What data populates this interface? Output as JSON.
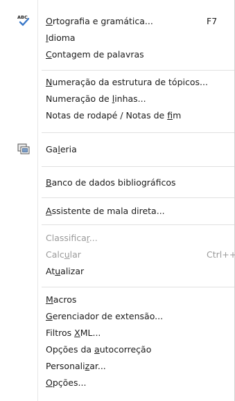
{
  "menu": {
    "group1": [
      {
        "pre": "",
        "key": "O",
        "post": "rtografia e gramática...",
        "shortcut": "F7",
        "icon": "spellcheck-icon"
      },
      {
        "pre": "",
        "key": "I",
        "post": "dioma",
        "shortcut": ""
      },
      {
        "pre": "",
        "key": "C",
        "post": "ontagem de palavras",
        "shortcut": ""
      }
    ],
    "group2": [
      {
        "pre": "",
        "key": "N",
        "post": "umeração da estrutura de tópicos...",
        "shortcut": ""
      },
      {
        "pre": "Numeração de ",
        "key": "l",
        "post": "inhas...",
        "shortcut": ""
      },
      {
        "pre": "Notas de rodapé / Notas de ",
        "key": "f",
        "post": "im",
        "shortcut": ""
      }
    ],
    "group3": [
      {
        "pre": "Ga",
        "key": "l",
        "post": "eria",
        "shortcut": "",
        "icon": "gallery-icon"
      }
    ],
    "group4": [
      {
        "pre": "",
        "key": "B",
        "post": "anco de dados bibliográficos",
        "shortcut": ""
      }
    ],
    "group5": [
      {
        "pre": "",
        "key": "A",
        "post": "ssistente de mala direta...",
        "shortcut": ""
      }
    ],
    "group6": [
      {
        "pre": "Classifica",
        "key": "r",
        "post": "...",
        "shortcut": "",
        "disabled": true
      },
      {
        "pre": "Calc",
        "key": "u",
        "post": "lar",
        "shortcut": "Ctrl++",
        "disabled": true
      },
      {
        "pre": "At",
        "key": "u",
        "post": "alizar",
        "shortcut": ""
      }
    ],
    "group7": [
      {
        "pre": "",
        "key": "M",
        "post": "acros",
        "shortcut": ""
      },
      {
        "pre": "",
        "key": "G",
        "post": "erenciador de extensão...",
        "shortcut": ""
      },
      {
        "pre": "Filtros ",
        "key": "X",
        "post": "ML...",
        "shortcut": ""
      },
      {
        "pre": "Opções da ",
        "key": "a",
        "post": "utocorreção",
        "shortcut": ""
      },
      {
        "pre": "Personali",
        "key": "z",
        "post": "ar...",
        "shortcut": ""
      },
      {
        "pre": "",
        "key": "O",
        "post": "pções...",
        "shortcut": ""
      }
    ]
  }
}
